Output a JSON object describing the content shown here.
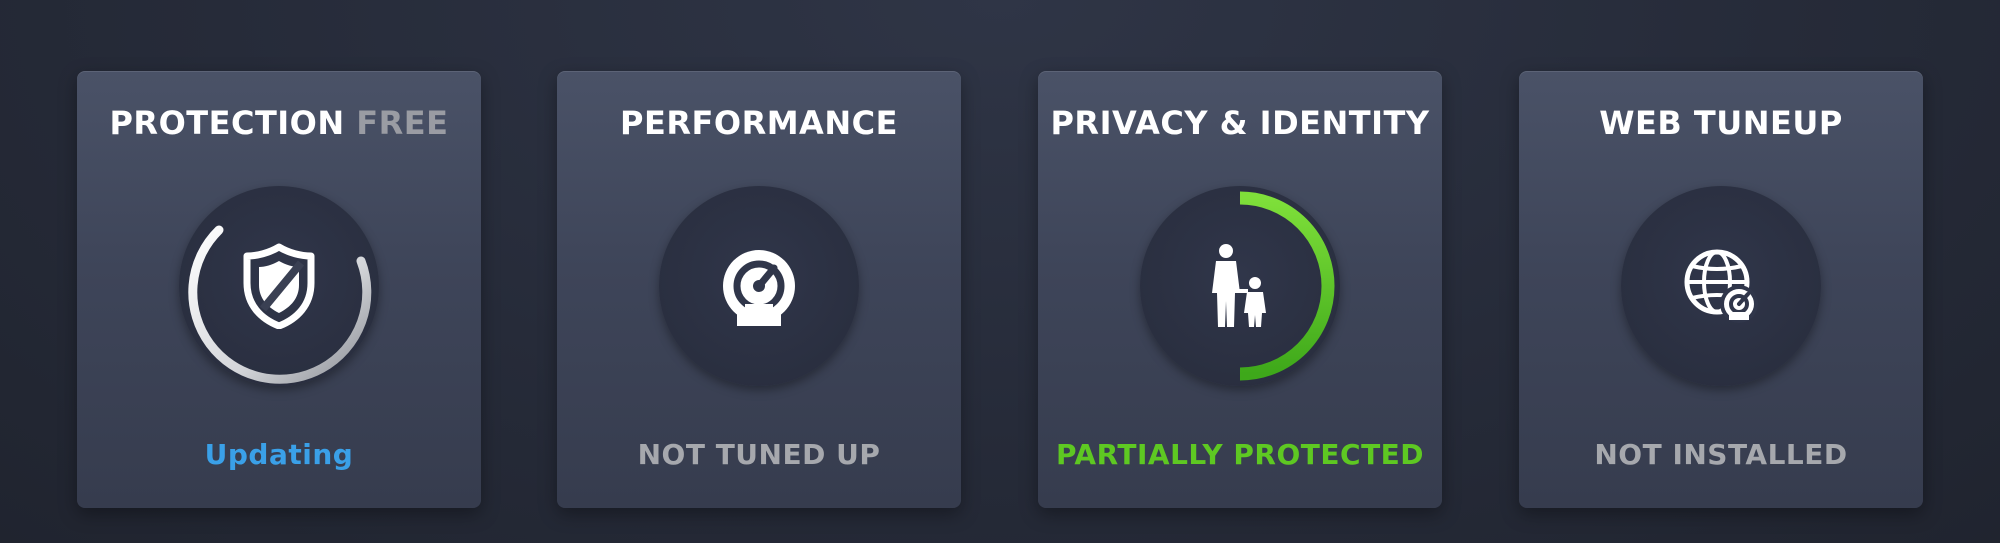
{
  "tiles": [
    {
      "title": "PROTECTION",
      "title_suffix": "FREE",
      "icon": "shield-icon",
      "status": "Updating",
      "status_color": "#3aa0e8"
    },
    {
      "title": "PERFORMANCE",
      "title_suffix": "",
      "icon": "speedometer-icon",
      "status": "NOT TUNED UP",
      "status_color": "#a6a8ad"
    },
    {
      "title": "PRIVACY & IDENTITY",
      "title_suffix": "",
      "icon": "family-icon",
      "status": "PARTIALLY PROTECTED",
      "status_color": "#5ec822",
      "progress": 0.5
    },
    {
      "title": "WEB TUNEUP",
      "title_suffix": "",
      "icon": "globe-speed-icon",
      "status": "NOT INSTALLED",
      "status_color": "#a6a8ad"
    }
  ]
}
